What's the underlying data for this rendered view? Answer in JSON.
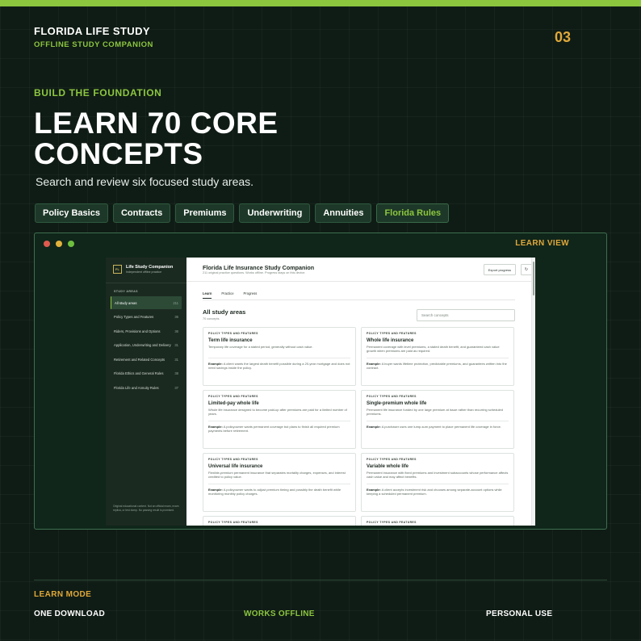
{
  "colors": {
    "accent_green": "#8cc63f",
    "accent_gold": "#e0a83a",
    "background": "#0f1c15"
  },
  "header": {
    "brand": "FLORIDA LIFE STUDY",
    "subtitle": "OFFLINE STUDY COMPANION",
    "page_number": "03"
  },
  "hero": {
    "eyebrow": "BUILD THE FOUNDATION",
    "headline": "LEARN 70 CORE CONCEPTS",
    "subhead": "Search and review six focused study areas."
  },
  "chips": [
    "Policy Basics",
    "Contracts",
    "Premiums",
    "Underwriting",
    "Annuities",
    "Florida Rules"
  ],
  "window": {
    "label": "LEARN VIEW"
  },
  "app": {
    "sidebar": {
      "logo": "FL",
      "title": "Life Study Companion",
      "subtitle": "Independent offline practice",
      "section": "STUDY AREAS",
      "items": [
        {
          "label": "All study areas",
          "count": "211"
        },
        {
          "label": "Policy Types and Features",
          "count": "36"
        },
        {
          "label": "Riders, Provisions and Options",
          "count": "36"
        },
        {
          "label": "Application, Underwriting and Delivery",
          "count": "31"
        },
        {
          "label": "Retirement and Related Concepts",
          "count": "31"
        },
        {
          "label": "Florida Ethics and General Rules",
          "count": "38"
        },
        {
          "label": "Florida Life and Annuity Rules",
          "count": "37"
        }
      ],
      "footer": "Original educational content. Not an official exam, exam replica, or test dump. No passing result is promised."
    },
    "main": {
      "title": "Florida Life Insurance Study Companion",
      "subtitle": "211 original practice questions. Works offline. Progress stays on this device.",
      "export_label": "Export progress",
      "refresh_icon": "↻",
      "tabs": [
        "Learn",
        "Practice",
        "Progress"
      ],
      "section_title": "All study areas",
      "section_count": "70 concepts",
      "search_placeholder": "Search concepts",
      "example_label": "Example:",
      "cards": [
        {
          "category": "POLICY TYPES AND FEATURES",
          "title": "Term life insurance",
          "desc": "Temporary life coverage for a stated period, generally without cash value.",
          "example": "A client wants the largest death benefit possible during a 20-year mortgage and does not need savings inside the policy."
        },
        {
          "category": "POLICY TYPES AND FEATURES",
          "title": "Whole life insurance",
          "desc": "Permanent coverage with level premiums, a stated death benefit, and guaranteed cash value growth when premiums are paid as required.",
          "example": "A buyer wants lifetime protection, predictable premiums, and guarantees written into the contract."
        },
        {
          "category": "POLICY TYPES AND FEATURES",
          "title": "Limited-pay whole life",
          "desc": "Whole life insurance designed to become paid-up after premiums are paid for a limited number of years.",
          "example": "A policyowner wants permanent coverage but plans to finish all required premium payments before retirement."
        },
        {
          "category": "POLICY TYPES AND FEATURES",
          "title": "Single-premium whole life",
          "desc": "Permanent life insurance funded by one large premium at issue rather than recurring scheduled premiums.",
          "example": "A purchaser uses one lump-sum payment to place permanent life coverage in force."
        },
        {
          "category": "POLICY TYPES AND FEATURES",
          "title": "Universal life insurance",
          "desc": "Flexible-premium permanent insurance that separates mortality charges, expenses, and interest credited to policy value.",
          "example": "A policyowner wants to adjust premium timing and possibly the death benefit while monitoring monthly policy charges."
        },
        {
          "category": "POLICY TYPES AND FEATURES",
          "title": "Variable whole life",
          "desc": "Permanent insurance with fixed premiums and investment subaccounts whose performance affects cash value and may affect benefits.",
          "example": "A client accepts investment risk and chooses among separate-account options while keeping a scheduled permanent premium."
        },
        {
          "category": "POLICY TYPES AND FEATURES"
        },
        {
          "category": "POLICY TYPES AND FEATURES"
        }
      ]
    }
  },
  "footer": {
    "mode": "LEARN MODE",
    "features": [
      "ONE DOWNLOAD",
      "WORKS OFFLINE",
      "PERSONAL USE"
    ]
  }
}
